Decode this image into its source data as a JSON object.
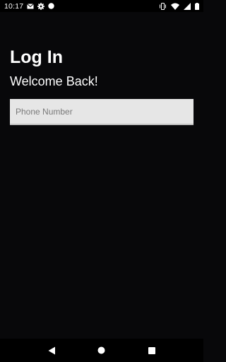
{
  "status_bar": {
    "time": "10:17",
    "left_icons": [
      "mail-icon",
      "gear-icon",
      "circle-icon"
    ],
    "right_icons": [
      "vibrate-icon",
      "wifi-icon",
      "signal-icon",
      "battery-icon"
    ]
  },
  "login": {
    "title": "Log In",
    "subtitle": "Welcome Back!",
    "phone_placeholder": "Phone Number",
    "phone_value": ""
  },
  "nav_bar": {
    "buttons": [
      "back-icon",
      "home-icon",
      "recents-icon"
    ]
  },
  "colors": {
    "background": "#08080a",
    "bars": "#000000",
    "input_background": "#e6e6e6",
    "text": "#ffffff"
  }
}
